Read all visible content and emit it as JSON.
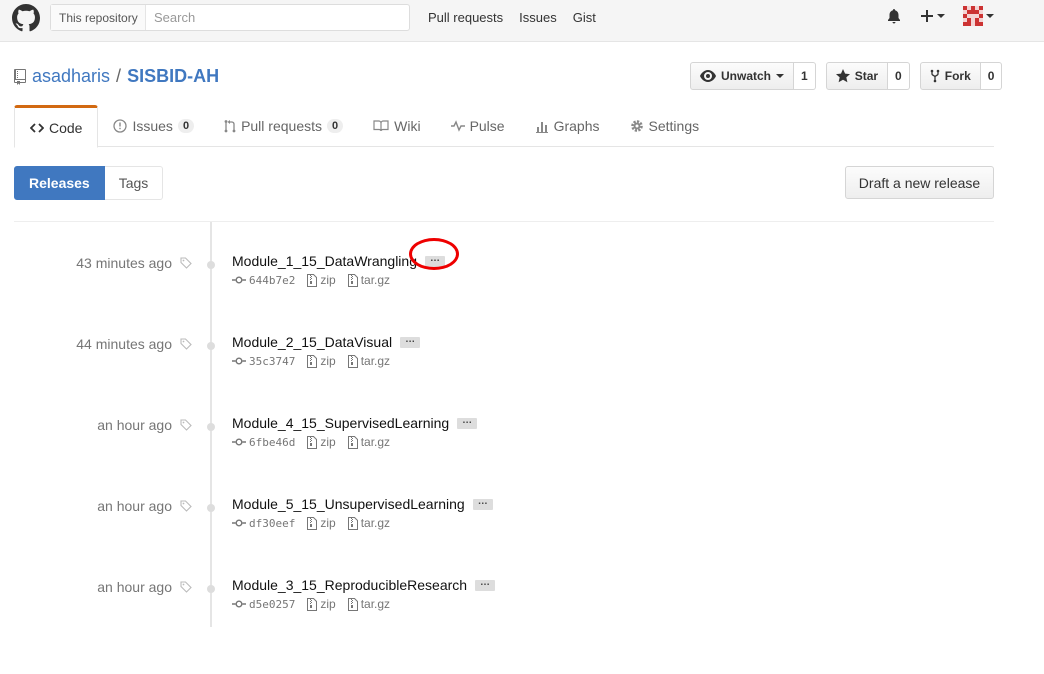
{
  "header": {
    "search_scope": "This repository",
    "search_placeholder": "Search",
    "nav": [
      "Pull requests",
      "Issues",
      "Gist"
    ]
  },
  "repo": {
    "owner": "asadharis",
    "separator": "/",
    "name": "SISBID-AH",
    "actions": {
      "watch_label": "Unwatch",
      "watch_count": "1",
      "star_label": "Star",
      "star_count": "0",
      "fork_label": "Fork",
      "fork_count": "0"
    }
  },
  "tabs": {
    "code": "Code",
    "issues": "Issues",
    "issues_count": "0",
    "pulls": "Pull requests",
    "pulls_count": "0",
    "wiki": "Wiki",
    "pulse": "Pulse",
    "graphs": "Graphs",
    "settings": "Settings"
  },
  "subnav": {
    "releases": "Releases",
    "tags": "Tags",
    "draft": "Draft a new release"
  },
  "releases": [
    {
      "date": "43 minutes ago",
      "title": "Module_1_15_DataWrangling",
      "commit": "644b7e2",
      "zip": "zip",
      "tar": "tar.gz"
    },
    {
      "date": "44 minutes ago",
      "title": "Module_2_15_DataVisual",
      "commit": "35c3747",
      "zip": "zip",
      "tar": "tar.gz"
    },
    {
      "date": "an hour ago",
      "title": "Module_4_15_SupervisedLearning",
      "commit": "6fbe46d",
      "zip": "zip",
      "tar": "tar.gz"
    },
    {
      "date": "an hour ago",
      "title": "Module_5_15_UnsupervisedLearning",
      "commit": "df30eef",
      "zip": "zip",
      "tar": "tar.gz"
    },
    {
      "date": "an hour ago",
      "title": "Module_3_15_ReproducibleResearch",
      "commit": "d5e0257",
      "zip": "zip",
      "tar": "tar.gz"
    }
  ],
  "ellipsis_label": "…",
  "colors": {
    "link": "#4078c0",
    "selected_tab_accent": "#d26911",
    "annotation": "#e00000"
  }
}
